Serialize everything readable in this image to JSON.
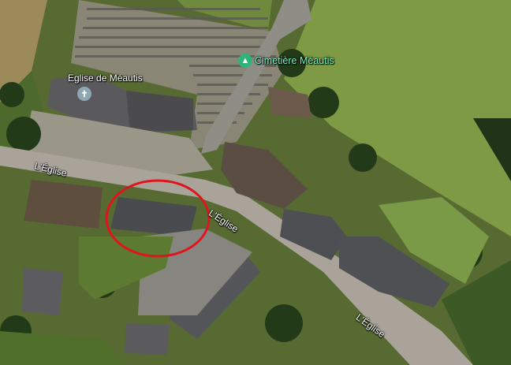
{
  "map": {
    "labels": {
      "church": "Eglise de Méautis",
      "cemetery": "Cimetière Méautis",
      "road_1": "L'Église",
      "road_2": "L'Église",
      "road_3": "L'Église"
    },
    "icons": {
      "church": "cross-icon",
      "cemetery": "tree-icon"
    },
    "colors": {
      "highlight": "#e0141e",
      "church_pin": "#8fa6b3",
      "cemetery_pin": "#2fb37a"
    }
  }
}
